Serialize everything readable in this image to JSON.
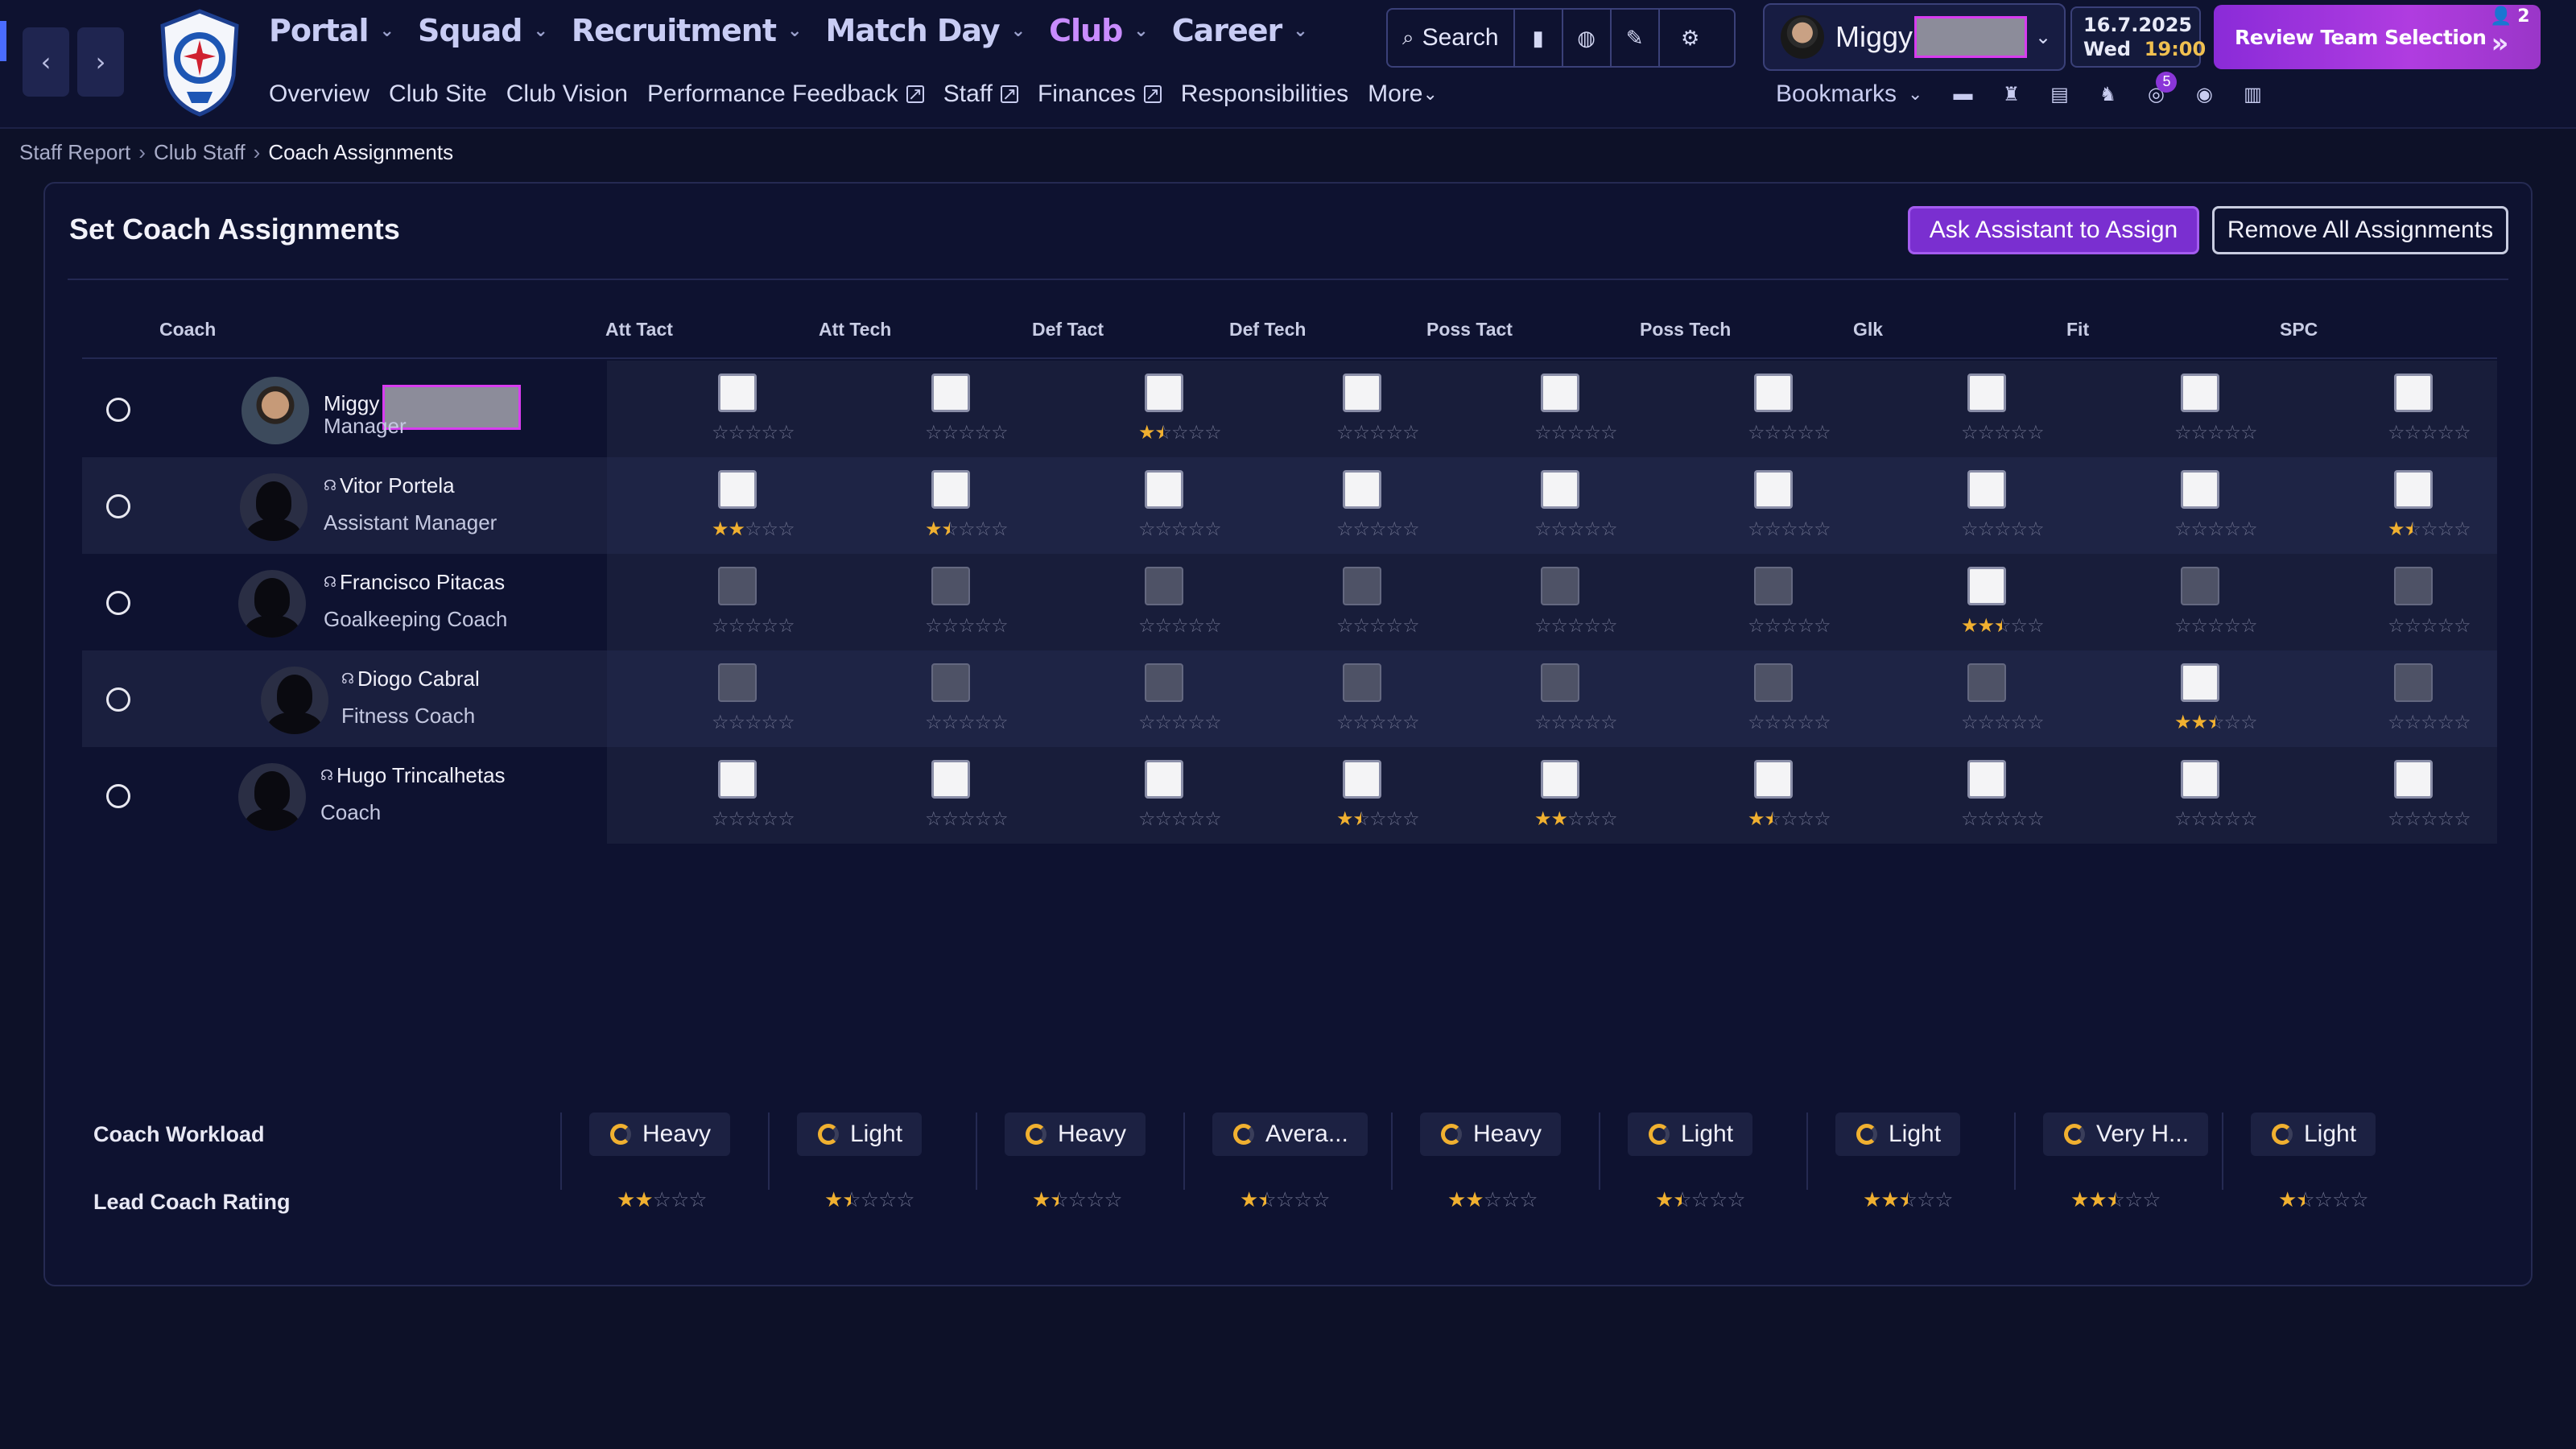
{
  "nav": {
    "main_items": [
      {
        "label": "Portal",
        "active": false
      },
      {
        "label": "Squad",
        "active": false
      },
      {
        "label": "Recruitment",
        "active": false
      },
      {
        "label": "Match Day",
        "active": false
      },
      {
        "label": "Club",
        "active": true
      },
      {
        "label": "Career",
        "active": false
      }
    ],
    "sub_items": [
      {
        "label": "Overview",
        "external": false
      },
      {
        "label": "Club Site",
        "external": false
      },
      {
        "label": "Club Vision",
        "external": false
      },
      {
        "label": "Performance Feedback",
        "external": true
      },
      {
        "label": "Staff",
        "external": true
      },
      {
        "label": "Finances",
        "external": true
      },
      {
        "label": "Responsibilities",
        "external": false
      },
      {
        "label": "More",
        "external": false
      }
    ]
  },
  "toolbar": {
    "search_label": "Search",
    "icons": [
      "bookmark-icon",
      "globe-icon",
      "pen-icon",
      "gear-icon"
    ]
  },
  "profile": {
    "name": "Miggy"
  },
  "date": {
    "date": "16.7.2025",
    "day": "Wed",
    "time": "19:00"
  },
  "review": {
    "label": "Review Team Selection",
    "count": "2"
  },
  "bookmarks": {
    "label": "Bookmarks",
    "icons": [
      "chat-icon",
      "shirt-icon",
      "clipboard-icon",
      "scout-icon",
      "messages-icon",
      "ball-icon",
      "notes-icon"
    ],
    "badge": "5"
  },
  "breadcrumb": {
    "items": [
      "Staff Report",
      "Club Staff"
    ],
    "current": "Coach Assignments"
  },
  "panel": {
    "title": "Set Coach Assignments",
    "ask_button": "Ask Assistant to Assign",
    "remove_button": "Remove All Assignments"
  },
  "table": {
    "coach_header": "Coach",
    "columns": [
      "Att Tact",
      "Att Tech",
      "Def Tact",
      "Def Tech",
      "Poss Tact",
      "Poss Tech",
      "Glk",
      "Fit",
      "SPC"
    ],
    "rows": [
      {
        "name": "Miggy",
        "role": "Manager",
        "headset": false,
        "redacted": true,
        "enabled": [
          true,
          true,
          true,
          true,
          true,
          true,
          true,
          true,
          true
        ],
        "ratings": [
          0,
          0,
          1.5,
          0,
          0,
          0,
          0,
          0,
          0
        ]
      },
      {
        "name": "Vitor Portela",
        "role": "Assistant Manager",
        "headset": true,
        "redacted": false,
        "enabled": [
          true,
          true,
          true,
          true,
          true,
          true,
          true,
          true,
          true
        ],
        "ratings": [
          2,
          1.5,
          0,
          0,
          0,
          0,
          0,
          0,
          1.5
        ]
      },
      {
        "name": "Francisco Pitacas",
        "role": "Goalkeeping Coach",
        "headset": true,
        "redacted": false,
        "enabled": [
          false,
          false,
          false,
          false,
          false,
          false,
          true,
          false,
          false
        ],
        "ratings": [
          0,
          0,
          0,
          0,
          0,
          0,
          2.5,
          0,
          0
        ]
      },
      {
        "name": "Diogo Cabral",
        "role": "Fitness Coach",
        "headset": true,
        "redacted": false,
        "enabled": [
          false,
          false,
          false,
          false,
          false,
          false,
          false,
          true,
          false
        ],
        "ratings": [
          0,
          0,
          0,
          0,
          0,
          0,
          0,
          2.5,
          0
        ]
      },
      {
        "name": "Hugo Trincalhetas",
        "role": "Coach",
        "headset": true,
        "redacted": false,
        "enabled": [
          true,
          true,
          true,
          true,
          true,
          true,
          true,
          true,
          true
        ],
        "ratings": [
          0,
          0,
          0,
          1.5,
          2,
          1.5,
          0,
          0,
          0
        ]
      }
    ]
  },
  "summary": {
    "workload_label": "Coach Workload",
    "lead_label": "Lead Coach Rating",
    "workload": [
      "Heavy",
      "Light",
      "Heavy",
      "Avera...",
      "Heavy",
      "Light",
      "Light",
      "Very H...",
      "Light"
    ],
    "lead_ratings": [
      2,
      1.5,
      1.5,
      1.5,
      2,
      1.5,
      2.5,
      2.5,
      1.5
    ]
  },
  "colors": {
    "accent": "#7a2fd0",
    "active_nav": "#c98cff",
    "star": "#f0b030"
  }
}
